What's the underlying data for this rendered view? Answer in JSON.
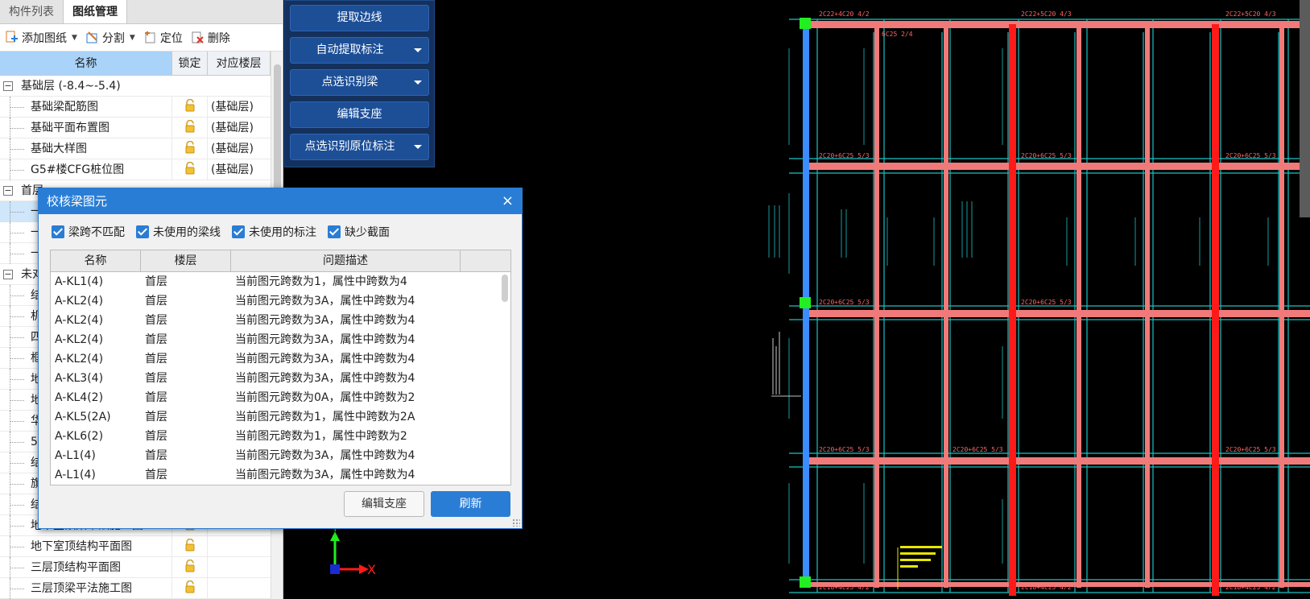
{
  "left_panel": {
    "tabs": [
      "构件列表",
      "图纸管理"
    ],
    "toolbar": {
      "add_drawing": "添加图纸",
      "split": "分割",
      "locate": "定位",
      "delete": "删除"
    },
    "columns": {
      "name": "名称",
      "lock": "锁定",
      "floor": "对应楼层"
    },
    "rows": [
      {
        "type": "group",
        "name": "基础层 (-8.4~-5.4)",
        "floor": ""
      },
      {
        "type": "child",
        "name": "基础梁配筋图",
        "floor": "(基础层)",
        "lock": true
      },
      {
        "type": "child",
        "name": "基础平面布置图",
        "floor": "(基础层)",
        "lock": true
      },
      {
        "type": "child",
        "name": "基础大样图",
        "floor": "(基础层)",
        "lock": true
      },
      {
        "type": "child",
        "name": "G5#楼CFG桩位图",
        "floor": "(基础层)",
        "lock": true
      },
      {
        "type": "group",
        "name": "首层",
        "floor": ""
      },
      {
        "type": "child",
        "name": "一",
        "floor": "",
        "lock": false,
        "selected": true
      },
      {
        "type": "child",
        "name": "一",
        "floor": "",
        "lock": false
      },
      {
        "type": "child",
        "name": "一",
        "floor": "",
        "lock": false
      },
      {
        "type": "group",
        "name": "未对",
        "floor": ""
      },
      {
        "type": "child",
        "name": "结",
        "floor": "",
        "lock": false
      },
      {
        "type": "child",
        "name": "机",
        "floor": "",
        "lock": false
      },
      {
        "type": "child",
        "name": "四",
        "floor": "",
        "lock": false
      },
      {
        "type": "child",
        "name": "框",
        "floor": "",
        "lock": false
      },
      {
        "type": "child",
        "name": "地",
        "floor": "",
        "lock": false
      },
      {
        "type": "child",
        "name": "地",
        "floor": "",
        "lock": false
      },
      {
        "type": "child",
        "name": "华",
        "floor": "",
        "lock": false
      },
      {
        "type": "child",
        "name": "5",
        "floor": "",
        "lock": false
      },
      {
        "type": "child",
        "name": "结",
        "floor": "",
        "lock": false
      },
      {
        "type": "child",
        "name": "旗",
        "floor": "",
        "lock": false
      },
      {
        "type": "child",
        "name": "结",
        "floor": "",
        "lock": false
      },
      {
        "type": "child",
        "name": "地下室顶梁平法施工图",
        "floor": "",
        "lock": true
      },
      {
        "type": "child",
        "name": "地下室顶结构平面图",
        "floor": "",
        "lock": true
      },
      {
        "type": "child",
        "name": "三层顶结构平面图",
        "floor": "",
        "lock": true
      },
      {
        "type": "child",
        "name": "三层顶梁平法施工图",
        "floor": "",
        "lock": true
      }
    ]
  },
  "command_panel": {
    "buttons": [
      {
        "label": "提取边线",
        "dropdown": false
      },
      {
        "label": "自动提取标注",
        "dropdown": true
      },
      {
        "label": "点选识别梁",
        "dropdown": true
      },
      {
        "label": "编辑支座",
        "dropdown": false
      },
      {
        "label": "点选识别原位标注",
        "dropdown": true
      }
    ]
  },
  "dialog": {
    "title": "校核梁图元",
    "close": "×",
    "filters": [
      "梁跨不匹配",
      "未使用的梁线",
      "未使用的标注",
      "缺少截面"
    ],
    "columns": [
      "名称",
      "楼层",
      "问题描述"
    ],
    "rows": [
      {
        "name": "A-KL1(4)",
        "floor": "首层",
        "desc": "当前图元跨数为1，属性中跨数为4"
      },
      {
        "name": "A-KL2(4)",
        "floor": "首层",
        "desc": "当前图元跨数为3A，属性中跨数为4"
      },
      {
        "name": "A-KL2(4)",
        "floor": "首层",
        "desc": "当前图元跨数为3A，属性中跨数为4"
      },
      {
        "name": "A-KL2(4)",
        "floor": "首层",
        "desc": "当前图元跨数为3A，属性中跨数为4"
      },
      {
        "name": "A-KL2(4)",
        "floor": "首层",
        "desc": "当前图元跨数为3A，属性中跨数为4"
      },
      {
        "name": "A-KL3(4)",
        "floor": "首层",
        "desc": "当前图元跨数为3A，属性中跨数为4"
      },
      {
        "name": "A-KL4(2)",
        "floor": "首层",
        "desc": "当前图元跨数为0A，属性中跨数为2"
      },
      {
        "name": "A-KL5(2A)",
        "floor": "首层",
        "desc": "当前图元跨数为1，属性中跨数为2A"
      },
      {
        "name": "A-KL6(2)",
        "floor": "首层",
        "desc": "当前图元跨数为1，属性中跨数为2"
      },
      {
        "name": "A-L1(4)",
        "floor": "首层",
        "desc": "当前图元跨数为3A，属性中跨数为4"
      },
      {
        "name": "A-L1(4)",
        "floor": "首层",
        "desc": "当前图元跨数为3A，属性中跨数为4"
      }
    ],
    "buttons": {
      "edit_support": "编辑支座",
      "refresh": "刷新"
    }
  },
  "canvas": {
    "axis_y": "Y",
    "axis_x": "X",
    "annotations_top": [
      "2C22+4C20 4/2",
      "2C22+5C20 4/3",
      "2C22+5C20 4/3"
    ],
    "annotations_row1": [
      "2C20+6C25 5/3",
      "2C20+6C25 5/3",
      "2C20+6C25 5/3"
    ],
    "annotations_row2": [
      "2C20+6C25 5/3",
      "2C20+6C25 5/3"
    ],
    "annotations_row3": [
      "2C20+6C25 5/3",
      "2C20+6C25 5/3",
      "2C20+6C25 5/3"
    ],
    "annotations_bottom": [
      "2C18+4C25 4/2",
      "2C18+4C25 4/2",
      "2C18+4C25 4/2"
    ],
    "small_note": "6C25 2/4",
    "colors": {
      "beam_red": "#ff1a1a",
      "beam_pink": "#f07a7a",
      "grid_cyan": "#19c2c2",
      "beam_blue": "#3b8cff",
      "node_green": "#22ee22",
      "note_yellow": "#e6e600"
    }
  }
}
